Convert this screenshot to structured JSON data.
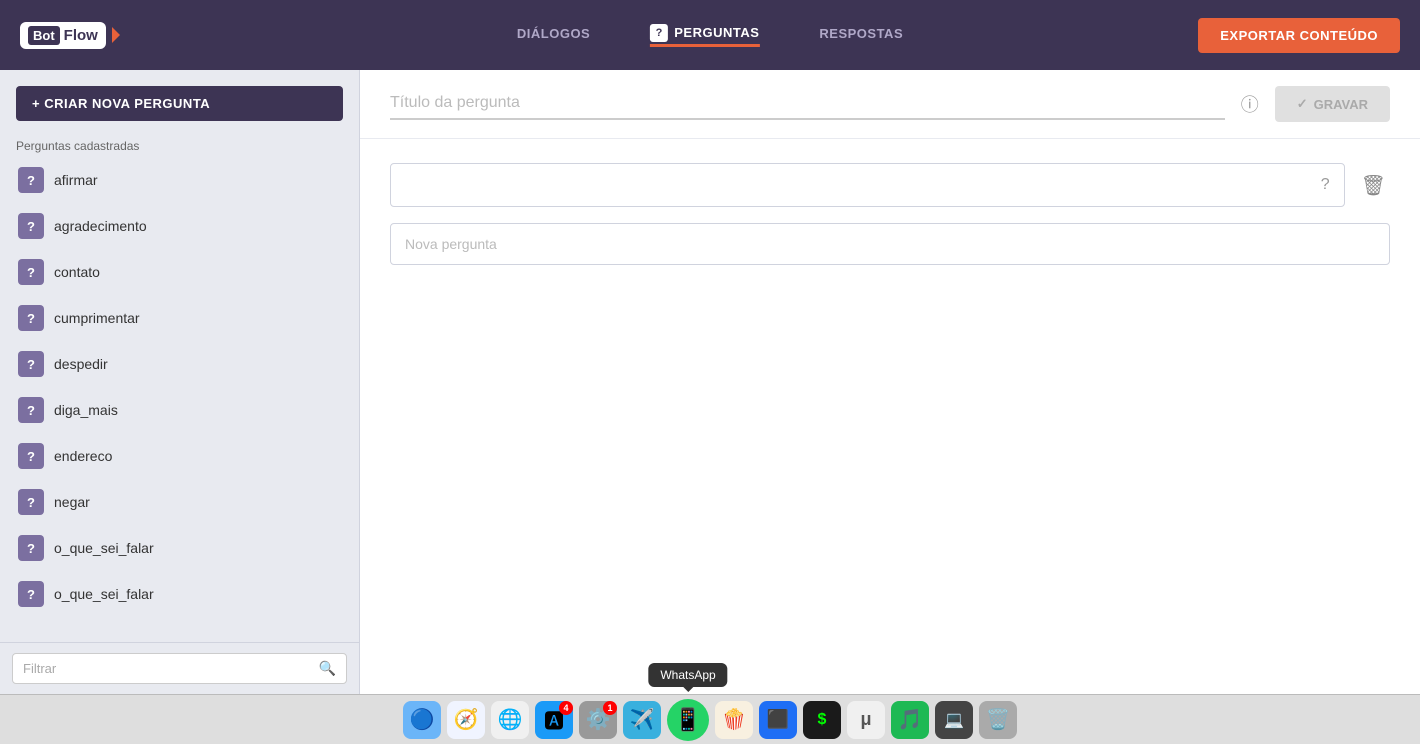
{
  "app": {
    "name": "Bot Flow",
    "logo_bot": "Bot",
    "logo_flow": "Flow"
  },
  "header": {
    "nav_items": [
      {
        "id": "dialogos",
        "label": "DIÁLOGOS",
        "active": false,
        "has_badge": false
      },
      {
        "id": "perguntas",
        "label": "PERGUNTAS",
        "active": true,
        "has_badge": true
      },
      {
        "id": "respostas",
        "label": "RESPOSTAS",
        "active": false,
        "has_badge": false
      }
    ],
    "export_btn": "EXPORTAR CONTEÚDO"
  },
  "sidebar": {
    "create_btn": "+ CRIAR NOVA PERGUNTA",
    "section_label": "Perguntas cadastradas",
    "items": [
      {
        "label": "afirmar",
        "icon": "?"
      },
      {
        "label": "agradecimento",
        "icon": "?"
      },
      {
        "label": "contato",
        "icon": "?"
      },
      {
        "label": "cumprimentar",
        "icon": "?"
      },
      {
        "label": "despedir",
        "icon": "?"
      },
      {
        "label": "diga_mais",
        "icon": "?"
      },
      {
        "label": "endereco",
        "icon": "?"
      },
      {
        "label": "negar",
        "icon": "?"
      },
      {
        "label": "o_que_sei_falar",
        "icon": "?"
      },
      {
        "label": "o_que_sei_falar",
        "icon": "?"
      }
    ],
    "filter_placeholder": "Filtrar"
  },
  "content": {
    "title_placeholder": "Título da pergunta",
    "save_btn": "GRAVAR",
    "question_box_qmark": "?",
    "new_question_placeholder": "Nova pergunta"
  },
  "dock": {
    "whatsapp_tooltip": "WhatsApp",
    "icons": [
      {
        "id": "finder",
        "emoji": "🔵",
        "bg": "#6bb5f8"
      },
      {
        "id": "safari",
        "emoji": "🧭",
        "bg": "#f0f0f0"
      },
      {
        "id": "chrome",
        "emoji": "🌐",
        "bg": "#f0f0f0"
      },
      {
        "id": "appstore",
        "emoji": "🅰",
        "bg": "#1a9af7",
        "badge": "4"
      },
      {
        "id": "settings",
        "emoji": "⚙️",
        "bg": "#888",
        "badge": "1"
      },
      {
        "id": "telegram",
        "emoji": "✈️",
        "bg": "#39b0de"
      },
      {
        "id": "whatsapp",
        "emoji": "📱",
        "bg": "#25d366"
      },
      {
        "id": "popcorn",
        "emoji": "🍿",
        "bg": "#f0f0f0"
      },
      {
        "id": "vscode",
        "emoji": "🟦",
        "bg": "#1e6ef5"
      },
      {
        "id": "terminal",
        "emoji": "💲",
        "bg": "#1a1a1a"
      },
      {
        "id": "mu",
        "emoji": "μ",
        "bg": "#f0f0f0"
      },
      {
        "id": "spotify",
        "emoji": "🎵",
        "bg": "#1db954"
      },
      {
        "id": "code2",
        "emoji": "💻",
        "bg": "#444"
      },
      {
        "id": "trash",
        "emoji": "🗑️",
        "bg": "#888"
      }
    ]
  }
}
